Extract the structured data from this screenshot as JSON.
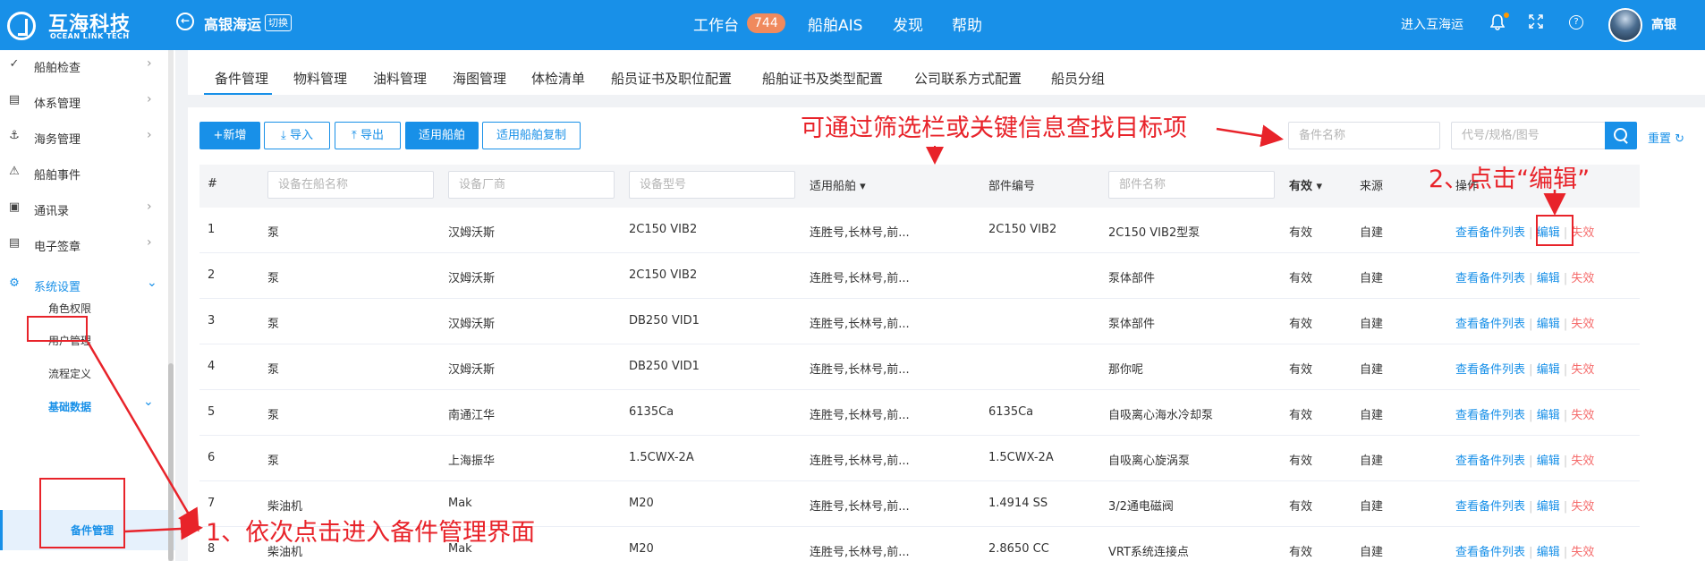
{
  "header": {
    "logo_cn": "互海科技",
    "logo_en": "OCEAN LINK TECH",
    "company": "高银海运",
    "switch_label": "切换",
    "nav": [
      {
        "label": "工作台",
        "badge": "744"
      },
      {
        "label": "船舶AIS"
      },
      {
        "label": "发现"
      },
      {
        "label": "帮助"
      }
    ],
    "enter_label": "进入互海运",
    "user_name": "高银",
    "icons": [
      "back-icon",
      "bell-icon",
      "fullscreen-icon",
      "help-icon"
    ]
  },
  "sidebar": {
    "items": [
      {
        "label": "船舶检查",
        "icon": "check-circle-icon"
      },
      {
        "label": "体系管理",
        "icon": "docs-icon"
      },
      {
        "label": "海务管理",
        "icon": "anchor-icon"
      },
      {
        "label": "船舶事件",
        "icon": "warning-icon"
      },
      {
        "label": "通讯录",
        "icon": "contacts-icon"
      },
      {
        "label": "电子签章",
        "icon": "seal-icon"
      },
      {
        "label": "系统设置",
        "icon": "gear-icon"
      }
    ],
    "sub_items": [
      "角色权限",
      "用户管理",
      "流程定义",
      "基础数据"
    ],
    "active_item": "备件管理"
  },
  "tabs": [
    "备件管理",
    "物料管理",
    "油料管理",
    "海图管理",
    "体检清单",
    "船员证书及职位配置",
    "船舶证书及类型配置",
    "公司联系方式配置",
    "船员分组"
  ],
  "toolbar": {
    "add": "+新增",
    "import": "导入",
    "export": "导出",
    "ship": "适用船舶",
    "ship_copy": "适用船舶复制",
    "search_name_placeholder": "备件名称",
    "search_code_placeholder": "代号/规格/图号",
    "reset": "重置"
  },
  "table": {
    "columns": [
      "#",
      "适用船舶",
      "部件编号",
      "有效",
      "来源",
      "操作"
    ],
    "filters": {
      "device_name": "设备在船名称",
      "maker": "设备厂商",
      "model": "设备型号",
      "part_name": "部件名称"
    },
    "actions": {
      "view": "查看备件列表",
      "edit": "编辑",
      "invalid": "失效"
    },
    "rows": [
      {
        "no": "1",
        "device": "泵",
        "maker": "汉姆沃斯",
        "model": "2C150 VIB2",
        "ships": "连胜号,长林号,前...",
        "part_no": "2C150 VIB2",
        "part_name": "2C150 VIB2型泵",
        "valid": "有效",
        "source": "自建"
      },
      {
        "no": "2",
        "device": "泵",
        "maker": "汉姆沃斯",
        "model": "2C150 VIB2",
        "ships": "连胜号,长林号,前...",
        "part_no": "",
        "part_name": "泵体部件",
        "valid": "有效",
        "source": "自建"
      },
      {
        "no": "3",
        "device": "泵",
        "maker": "汉姆沃斯",
        "model": "DB250 VID1",
        "ships": "连胜号,长林号,前...",
        "part_no": "",
        "part_name": "泵体部件",
        "valid": "有效",
        "source": "自建"
      },
      {
        "no": "4",
        "device": "泵",
        "maker": "汉姆沃斯",
        "model": "DB250 VID1",
        "ships": "连胜号,长林号,前...",
        "part_no": "",
        "part_name": "那你呢",
        "valid": "有效",
        "source": "自建"
      },
      {
        "no": "5",
        "device": "泵",
        "maker": "南通江华",
        "model": "6135Ca",
        "ships": "连胜号,长林号,前...",
        "part_no": "6135Ca",
        "part_name": "自吸离心海水冷却泵",
        "valid": "有效",
        "source": "自建"
      },
      {
        "no": "6",
        "device": "泵",
        "maker": "上海振华",
        "model": "1.5CWX-2A",
        "ships": "连胜号,长林号,前...",
        "part_no": "1.5CWX-2A",
        "part_name": "自吸离心旋涡泵",
        "valid": "有效",
        "source": "自建"
      },
      {
        "no": "7",
        "device": "柴油机",
        "maker": "Mak",
        "model": "M20",
        "ships": "连胜号,长林号,前...",
        "part_no": "1.4914 SS",
        "part_name": "3/2通电磁阀",
        "valid": "有效",
        "source": "自建"
      },
      {
        "no": "8",
        "device": "柴油机",
        "maker": "Mak",
        "model": "M20",
        "ships": "连胜号,长林号,前...",
        "part_no": "2.8650 CC",
        "part_name": "VRT系统连接点",
        "valid": "有效",
        "source": "自建"
      }
    ]
  },
  "annotations": {
    "filter_tip": "可通过筛选栏或关键信息查找目标项",
    "step1": "1、依次点击进入备件管理界面",
    "step2": "2、点击“编辑”"
  },
  "colors": {
    "primary": "#1890e8",
    "badge": "#f08a5d",
    "danger": "#f56c6c",
    "annotation": "#e8232a"
  }
}
